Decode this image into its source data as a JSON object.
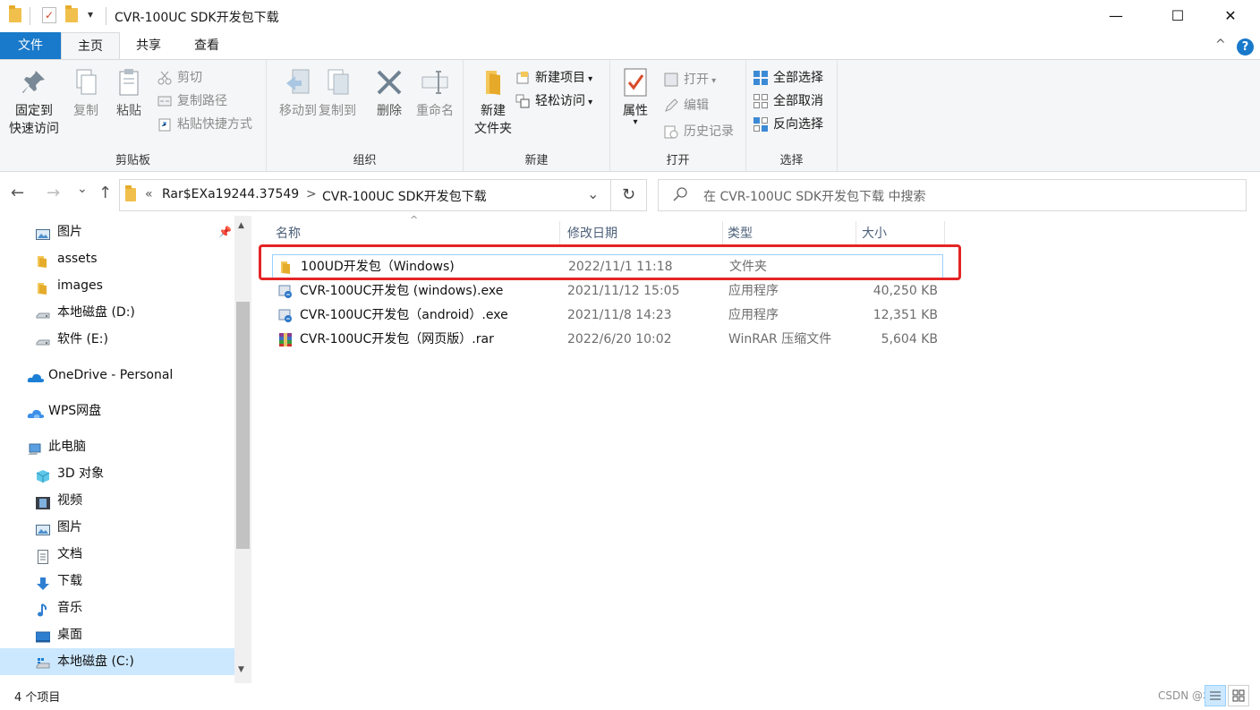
{
  "window": {
    "title": "CVR-100UC  SDK开发包下载",
    "qat_dropdown": "▾",
    "minimize": "—",
    "maximize": "☐",
    "close": "✕"
  },
  "ribbon_tabs": [
    "文件",
    "主页",
    "共享",
    "查看"
  ],
  "ribbon_extra": {
    "collapse": "^",
    "help": "?"
  },
  "clipboard": {
    "pin_line1": "固定到",
    "pin_line2": "快速访问",
    "copy": "复制",
    "paste": "粘贴",
    "cut": "剪切",
    "copy_path": "复制路径",
    "paste_shortcut": "粘贴快捷方式",
    "label": "剪贴板"
  },
  "organize": {
    "move_to": "移动到",
    "copy_to": "复制到",
    "delete": "删除",
    "rename": "重命名",
    "label": "组织"
  },
  "new": {
    "new_item": "新建项目",
    "easy_access": "轻松访问",
    "new_folder_line1": "新建",
    "new_folder_line2": "文件夹",
    "label": "新建"
  },
  "open": {
    "properties": "属性",
    "open": "打开",
    "edit": "编辑",
    "history": "历史记录",
    "label": "打开"
  },
  "select": {
    "select_all": "全部选择",
    "select_none": "全部取消",
    "invert": "反向选择",
    "label": "选择"
  },
  "nav": {
    "back": "←",
    "forward": "→",
    "recent": "⌄",
    "up": "↑",
    "breadcrumb_prefix": "«",
    "crumb1": "Rar$EXa19244.37549",
    "separator": ">",
    "crumb2": "CVR-100UC  SDK开发包下载",
    "dropdown": "⌄",
    "refresh": "↻",
    "search_placeholder": "在 CVR-100UC  SDK开发包下载 中搜索"
  },
  "sidebar": [
    {
      "label": "图片",
      "icon": "pictures-icon"
    },
    {
      "label": "assets",
      "icon": "folder-icon"
    },
    {
      "label": "images",
      "icon": "folder-icon"
    },
    {
      "label": "本地磁盘 (D:)",
      "icon": "drive-icon"
    },
    {
      "label": "软件 (E:)",
      "icon": "drive-icon"
    },
    {
      "label": "OneDrive - Personal",
      "icon": "onedrive-icon"
    },
    {
      "label": "WPS网盘",
      "icon": "cloud-icon"
    },
    {
      "label": "此电脑",
      "icon": "computer-icon"
    },
    {
      "label": "3D 对象",
      "icon": "3d-objects-icon"
    },
    {
      "label": "视频",
      "icon": "videos-icon"
    },
    {
      "label": "图片",
      "icon": "pictures-icon"
    },
    {
      "label": "文档",
      "icon": "documents-icon"
    },
    {
      "label": "下载",
      "icon": "downloads-icon"
    },
    {
      "label": "音乐",
      "icon": "music-icon"
    },
    {
      "label": "桌面",
      "icon": "desktop-icon"
    },
    {
      "label": "本地磁盘 (C:)",
      "icon": "windows-drive-icon"
    }
  ],
  "columns": {
    "name": "名称",
    "date": "修改日期",
    "type": "类型",
    "size": "大小",
    "sort_indicator": "^"
  },
  "files": [
    {
      "name": "100UD开发包（Windows)",
      "date": "2022/11/1 11:18",
      "type": "文件夹",
      "size": "",
      "icon": "folder-icon"
    },
    {
      "name": "CVR-100UC开发包 (windows).exe",
      "date": "2021/11/12 15:05",
      "type": "应用程序",
      "size": "40,250 KB",
      "icon": "installer-icon"
    },
    {
      "name": "CVR-100UC开发包（android）.exe",
      "date": "2021/11/8 14:23",
      "type": "应用程序",
      "size": "12,351 KB",
      "icon": "installer-icon"
    },
    {
      "name": "CVR-100UC开发包（网页版）.rar",
      "date": "2022/6/20 10:02",
      "type": "WinRAR 压缩文件",
      "size": "5,604 KB",
      "icon": "winrar-icon"
    }
  ],
  "status": {
    "count": "4 个项目",
    "watermark": "CSDN @君乙"
  },
  "colors": {
    "accent": "#1979ca",
    "highlight_box": "#e42424",
    "selection_border": "#99d1ff"
  }
}
